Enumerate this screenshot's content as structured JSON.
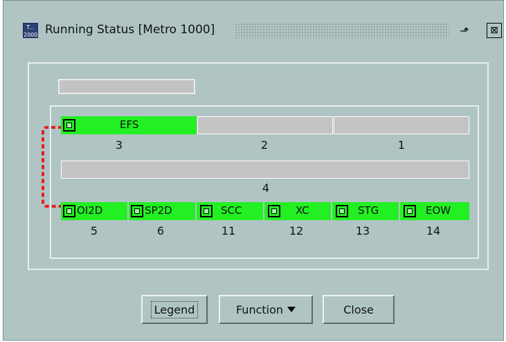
{
  "window": {
    "title": "Running Status [Metro 1000]",
    "icon_top": "T...",
    "icon_bottom": "2000",
    "minimize_icon": "restore-icon",
    "close_icon": "close-icon",
    "close_glyph": "⊠",
    "min_glyph": "⬏"
  },
  "chassis": {
    "row1": [
      {
        "slot_number": "3",
        "label": "EFS",
        "active": true,
        "led": true
      },
      {
        "slot_number": "2",
        "label": "",
        "active": false,
        "led": false
      },
      {
        "slot_number": "1",
        "label": "",
        "active": false,
        "led": false
      }
    ],
    "row2": [
      {
        "slot_number": "4",
        "label": "",
        "active": false,
        "led": false
      }
    ],
    "row3": [
      {
        "slot_number": "5",
        "label": "OI2D",
        "active": true,
        "led": true
      },
      {
        "slot_number": "6",
        "label": "SP2D",
        "active": true,
        "led": true
      },
      {
        "slot_number": "11",
        "label": "SCC",
        "active": true,
        "led": true
      },
      {
        "slot_number": "12",
        "label": "XC",
        "active": true,
        "led": true
      },
      {
        "slot_number": "13",
        "label": "STG",
        "active": true,
        "led": true
      },
      {
        "slot_number": "14",
        "label": "EOW",
        "active": true,
        "led": true
      }
    ]
  },
  "colors": {
    "active_board": "#22f022",
    "empty_slot": "#c3c3c3",
    "fiber": "#e02020",
    "window_bg": "#b0c4c4"
  },
  "buttons": {
    "legend": "Legend",
    "function": "Function",
    "close": "Close"
  }
}
